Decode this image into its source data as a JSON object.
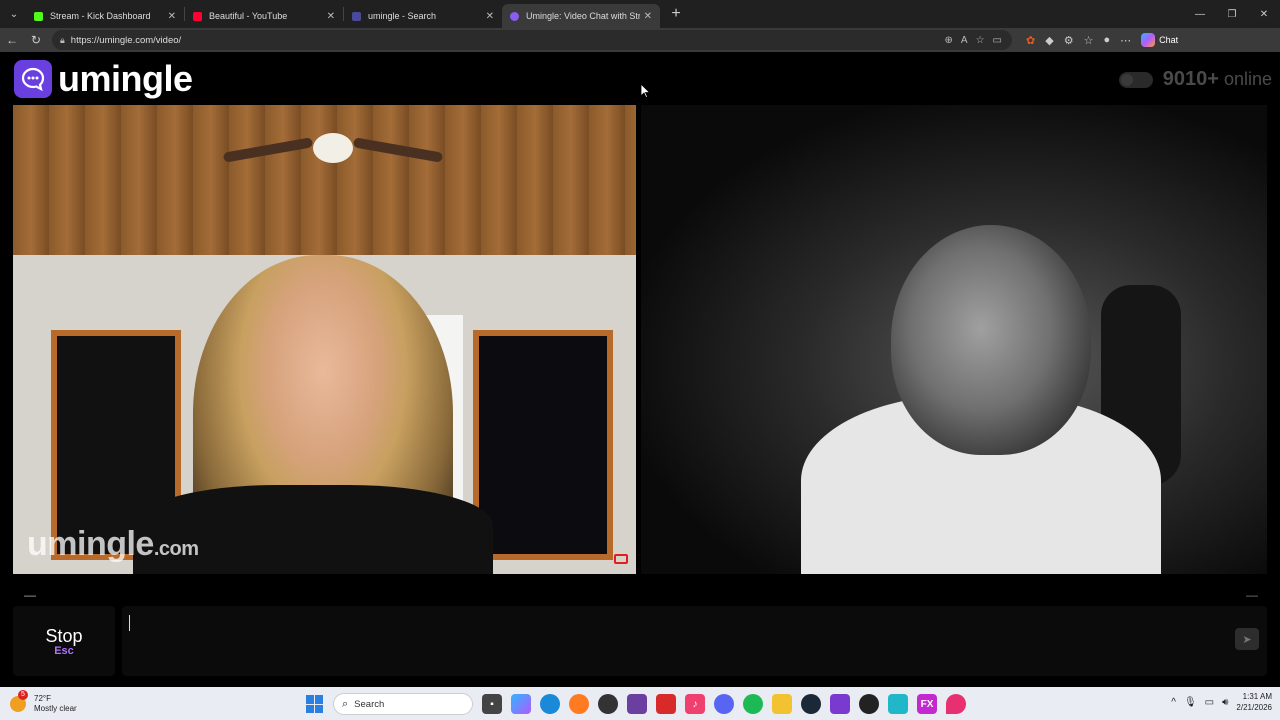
{
  "browser": {
    "tabs": [
      {
        "label": "Stream - Kick Dashboard",
        "color": "#53fc18"
      },
      {
        "label": "Beautiful - YouTube",
        "color": "#ff0033"
      },
      {
        "label": "umingle - Search",
        "color": "#4a4a9a"
      },
      {
        "label": "Umingle: Video Chat with Str",
        "color": "#8a5cf0"
      }
    ],
    "new_tab": "+",
    "url": "https://umingle.com/video/",
    "chat_label": "Chat"
  },
  "site": {
    "logo_text": "umingle",
    "online_count": "9010+",
    "online_label": "online",
    "watermark": "umingle",
    "watermark_suffix": ".com",
    "stop_label": "Stop",
    "stop_hint": "Esc",
    "accent": "#6a3fe0"
  },
  "taskbar": {
    "temperature": "72°F",
    "weather": "Mostly clear",
    "weather_badge": "5",
    "search_placeholder": "Search",
    "time": "1:31 AM",
    "date": "2/21/2026"
  }
}
